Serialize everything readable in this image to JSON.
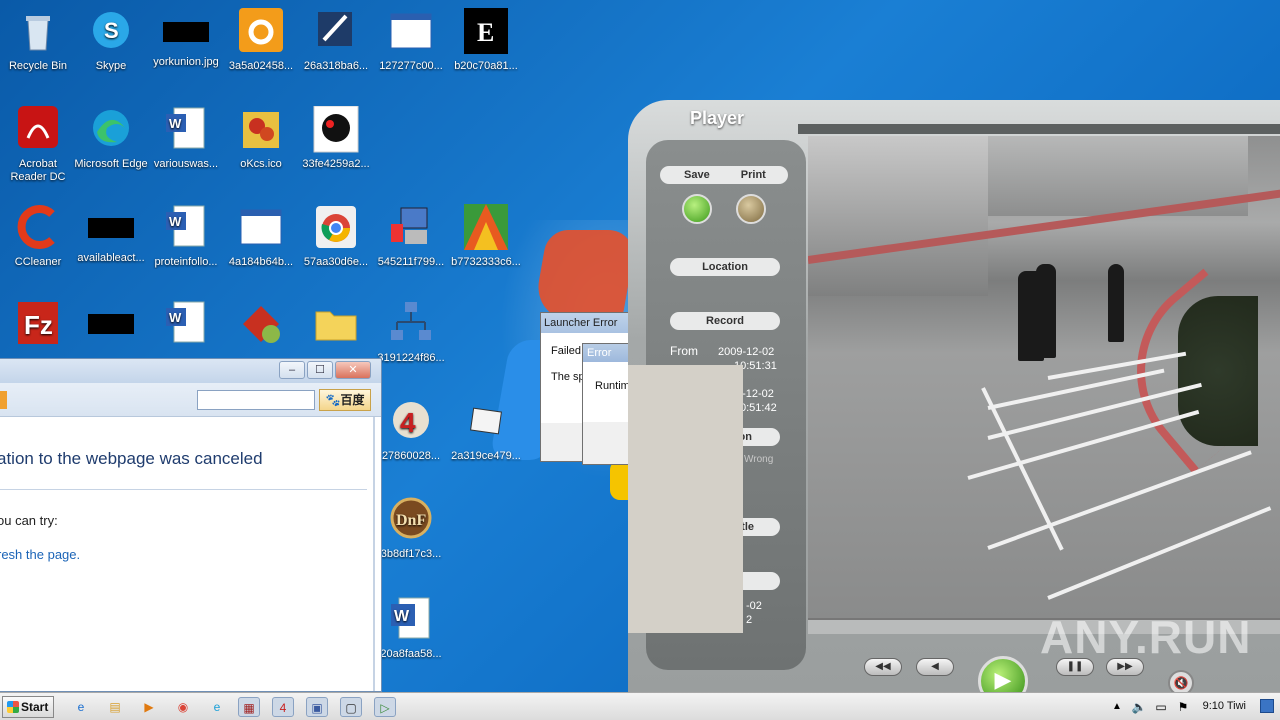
{
  "desktop_icons": [
    {
      "label": "Recycle Bin"
    },
    {
      "label": "Skype"
    },
    {
      "label": "yorkunion.jpg"
    },
    {
      "label": "3a5a02458..."
    },
    {
      "label": "26a318ba6..."
    },
    {
      "label": "127277c00..."
    },
    {
      "label": "b20c70a81..."
    },
    {
      "label": "Acrobat Reader DC"
    },
    {
      "label": "Microsoft Edge"
    },
    {
      "label": "variouswas..."
    },
    {
      "label": "oKcs.ico"
    },
    {
      "label": "33fe4259a2..."
    },
    {
      "label": "CCleaner"
    },
    {
      "label": "availableact..."
    },
    {
      "label": "proteinfollo..."
    },
    {
      "label": "4a184b64b..."
    },
    {
      "label": "57aa30d6e..."
    },
    {
      "label": "545211f799..."
    },
    {
      "label": "b7732333c6..."
    },
    {
      "label": "3191224f86..."
    },
    {
      "label": "27860028..."
    },
    {
      "label": "2a319ce479..."
    },
    {
      "label": "3b8df17c3..."
    },
    {
      "label": "20a8faa58..."
    }
  ],
  "browser": {
    "baidu_label": "百度",
    "headline": "ation to the webpage was canceled",
    "tip": "ou can try:",
    "refresh": "resh the page."
  },
  "launcher_error": {
    "title": "Launcher Error",
    "line1": "Failed",
    "line2": "The sp"
  },
  "error_dialog": {
    "title": "Error",
    "body": "Runtim"
  },
  "player": {
    "title": "Player",
    "save_label": "Save",
    "print_label": "Print",
    "location_label": "Location",
    "record_label": "Record",
    "from_label": "From",
    "from_date": "2009-12-02",
    "from_time": "10:51:31",
    "to_date": "9-12-02",
    "to_time": "0:51:42",
    "third_pill_partial": "on",
    "wrong_text": "Wrong",
    "title_pill_partial": "itle",
    "bottom_date_partial": "-02",
    "bottom_time_partial": "2"
  },
  "watermark": "ANY.RUN",
  "taskbar": {
    "start_label": "Start",
    "clock": "9:10 Tiwi"
  }
}
